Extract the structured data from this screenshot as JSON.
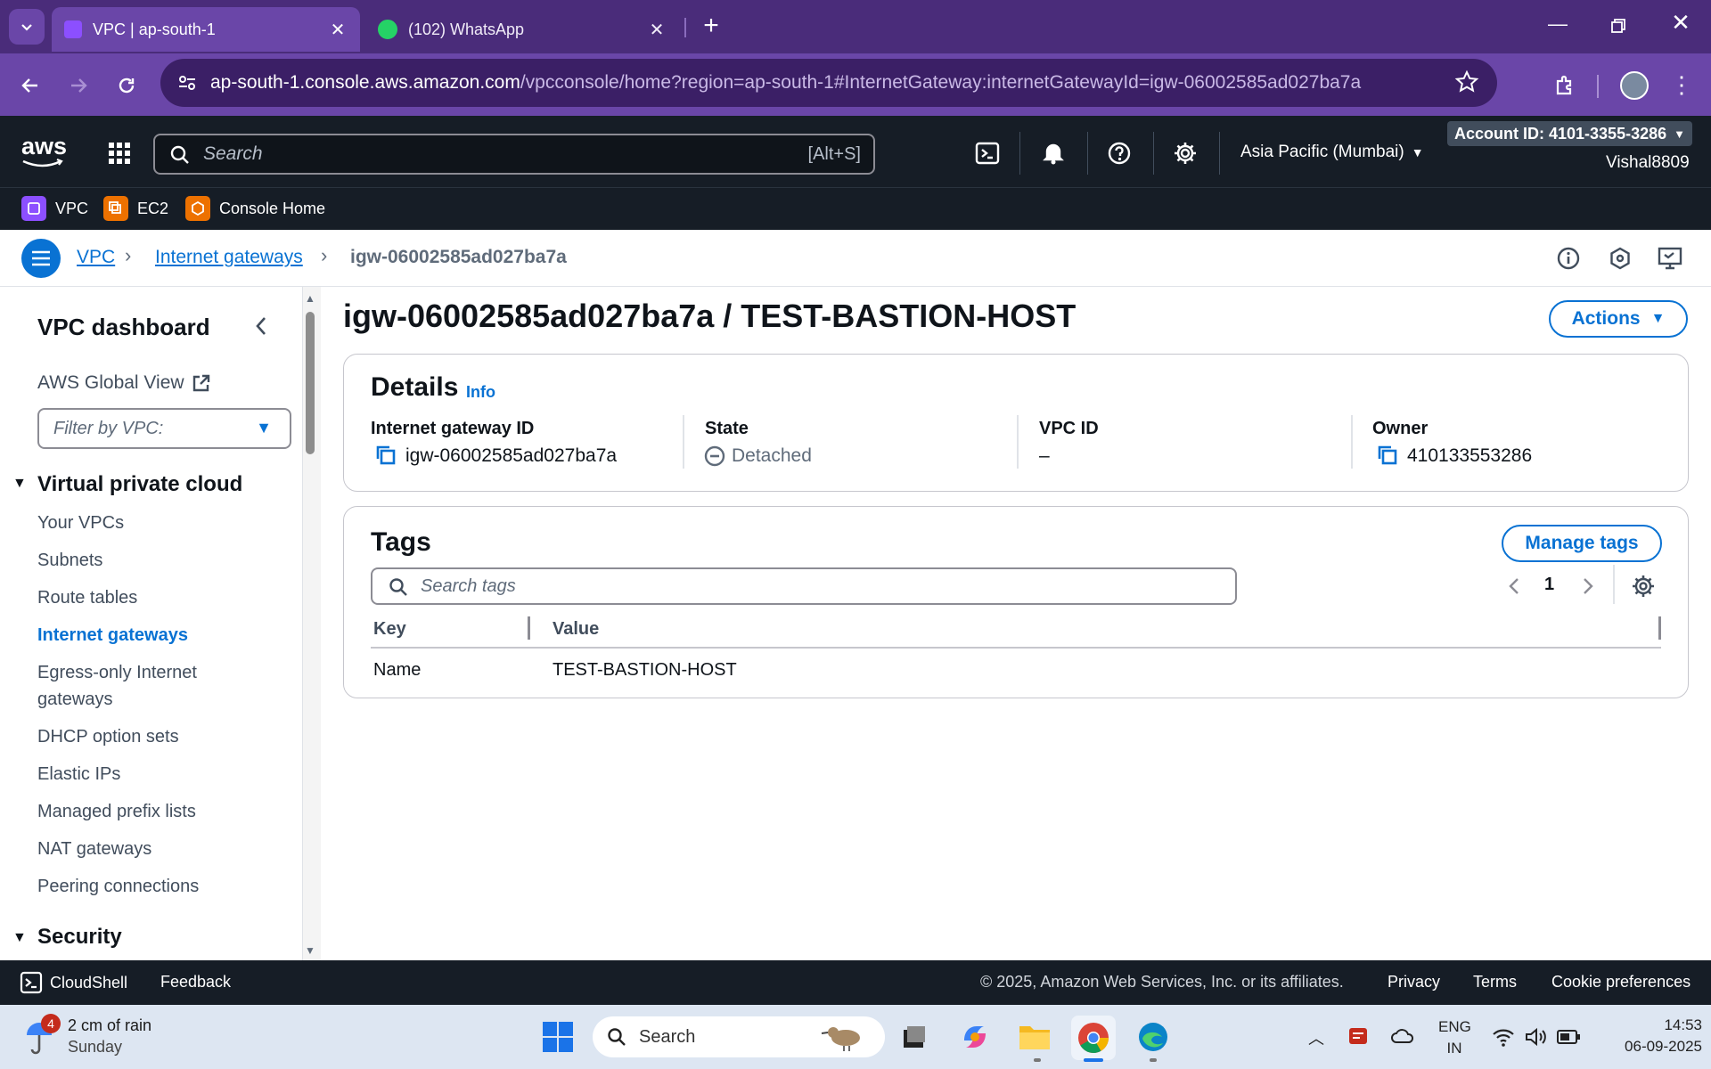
{
  "browser": {
    "tabs": [
      {
        "label": "VPC | ap-south-1",
        "active": true
      },
      {
        "label": "(102) WhatsApp",
        "active": false
      }
    ],
    "url_host": "ap-south-1.console.aws.amazon.com",
    "url_path": "/vpcconsole/home?region=ap-south-1#InternetGateway:internetGatewayId=igw-06002585ad027ba7a"
  },
  "aws_header": {
    "search_placeholder": "Search",
    "search_shortcut": "[Alt+S]",
    "region": "Asia Pacific (Mumbai)",
    "account_id": "Account ID: 4101-3355-3286",
    "username": "Vishal8809"
  },
  "favorites": [
    {
      "label": "VPC",
      "color": "#8c4fff"
    },
    {
      "label": "EC2",
      "color": "#ed7100"
    },
    {
      "label": "Console Home",
      "color": "#ed7100"
    }
  ],
  "breadcrumb": {
    "items": [
      "VPC",
      "Internet gateways",
      "igw-06002585ad027ba7a"
    ]
  },
  "sidebar": {
    "title": "VPC dashboard",
    "global_view": "AWS Global View",
    "filter_placeholder": "Filter by VPC:",
    "section_vpc": "Virtual private cloud",
    "items": [
      "Your VPCs",
      "Subnets",
      "Route tables",
      "Internet gateways",
      "Egress-only Internet",
      "gateways",
      "DHCP option sets",
      "Elastic IPs",
      "Managed prefix lists",
      "NAT gateways",
      "Peering connections"
    ],
    "active_item": "Internet gateways",
    "section_security": "Security"
  },
  "page": {
    "title": "igw-06002585ad027ba7a / TEST-BASTION-HOST",
    "actions_label": "Actions"
  },
  "details": {
    "heading": "Details",
    "info_label": "Info",
    "fields": [
      {
        "label": "Internet gateway ID",
        "value": "igw-06002585ad027ba7a"
      },
      {
        "label": "State",
        "value": "Detached"
      },
      {
        "label": "VPC ID",
        "value": "–"
      },
      {
        "label": "Owner",
        "value": "410133553286"
      }
    ]
  },
  "tags": {
    "heading": "Tags",
    "manage_label": "Manage tags",
    "search_placeholder": "Search tags",
    "page_number": "1",
    "columns": [
      "Key",
      "Value"
    ],
    "rows": [
      {
        "key": "Name",
        "value": "TEST-BASTION-HOST"
      }
    ]
  },
  "footer": {
    "cloudshell": "CloudShell",
    "feedback": "Feedback",
    "copyright": "© 2025, Amazon Web Services, Inc. or its affiliates.",
    "privacy": "Privacy",
    "terms": "Terms",
    "cookie": "Cookie preferences"
  },
  "taskbar": {
    "weather_badge": "4",
    "weather_text": "2 cm of rain",
    "weather_day": "Sunday",
    "search_label": "Search",
    "lang_top": "ENG",
    "lang_bottom": "IN",
    "time": "14:53",
    "date": "06-09-2025"
  },
  "colors": {
    "tabstrip": "#4a2c7a",
    "toolbar": "#6a46a8",
    "aws_dark": "#161d26",
    "link_blue": "#0972d3"
  }
}
